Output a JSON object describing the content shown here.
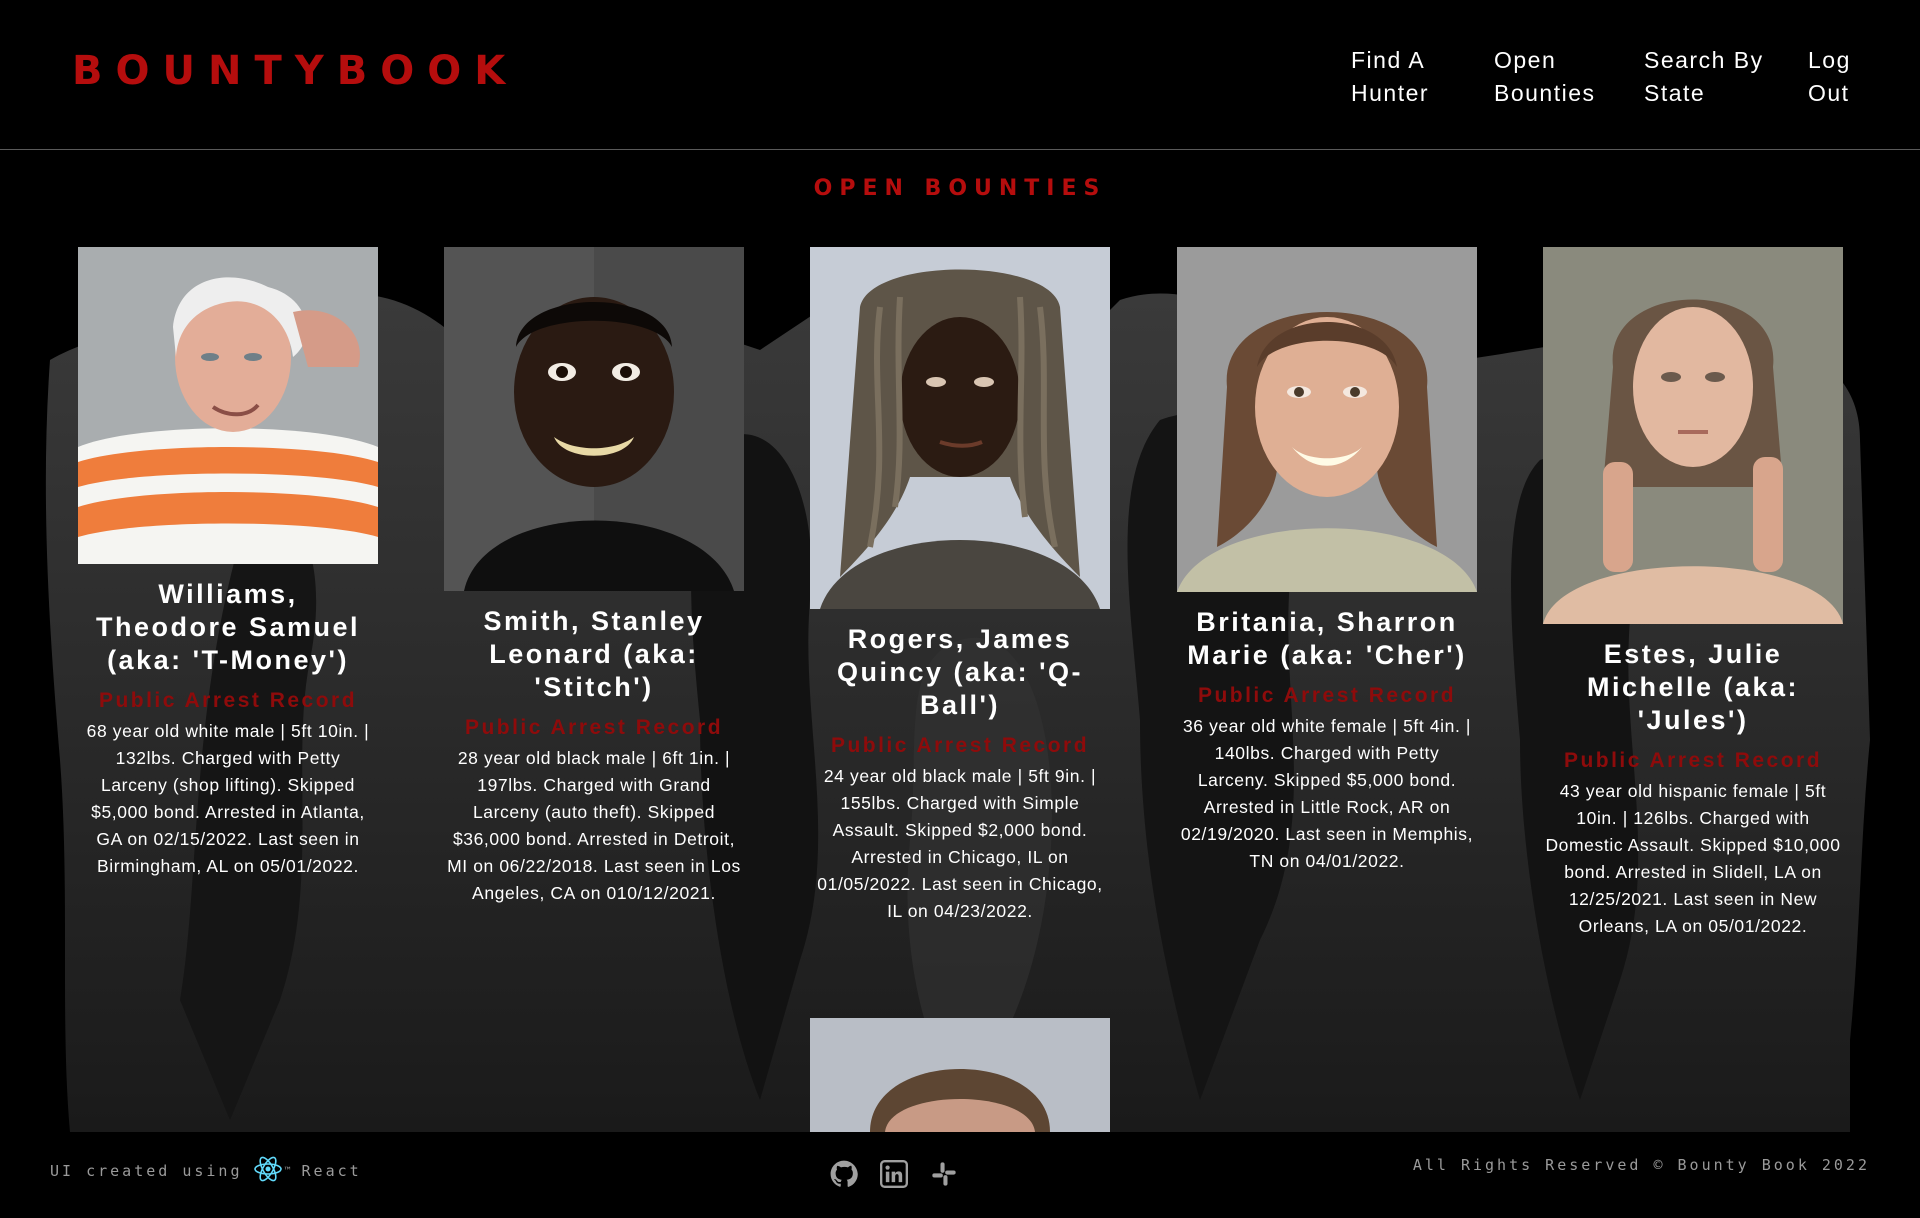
{
  "header": {
    "logo": "BOUNTYBOOK",
    "nav": [
      {
        "line1": "Find A",
        "line2": "Hunter"
      },
      {
        "line1": "Open",
        "line2": "Bounties"
      },
      {
        "line1": "Search By",
        "line2": "State"
      },
      {
        "line1": "Log",
        "line2": "Out"
      }
    ]
  },
  "main": {
    "title": "OPEN BOUNTIES",
    "cards": [
      {
        "name": "Williams, Theodore Samuel (aka: 'T-Money')",
        "record_label": "Public Arrest Record",
        "description": "68 year old white male | 5ft 10in. | 132lbs. Charged with Petty Larceny (shop lifting). Skipped $5,000 bond. Arrested in Atlanta, GA on 02/15/2022. Last seen in Birmingham, AL on 05/01/2022."
      },
      {
        "name": "Smith, Stanley Leonard (aka: 'Stitch')",
        "record_label": "Public Arrest Record",
        "description": "28 year old black male | 6ft 1in. | 197lbs. Charged with Grand Larceny (auto theft). Skipped $36,000 bond. Arrested in Detroit, MI on 06/22/2018. Last seen in Los Angeles, CA on 010/12/2021."
      },
      {
        "name": "Rogers, James Quincy (aka: 'Q-Ball')",
        "record_label": "Public Arrest Record",
        "description": "24 year old black male | 5ft 9in. | 155lbs. Charged with Simple Assault. Skipped $2,000 bond. Arrested in Chicago, IL on 01/05/2022. Last seen in Chicago, IL on 04/23/2022."
      },
      {
        "name": "Britania, Sharron Marie (aka: 'Cher')",
        "record_label": "Public Arrest Record",
        "description": "36 year old white female | 5ft 4in. | 140lbs. Charged with Petty Larceny. Skipped $5,000 bond. Arrested in Little Rock, AR on 02/19/2020. Last seen in Memphis, TN on 04/01/2022."
      },
      {
        "name": "Estes, Julie Michelle (aka: 'Jules')",
        "record_label": "Public Arrest Record",
        "description": "43 year old hispanic female | 5ft 10in. | 126lbs. Charged with Domestic Assault. Skipped $10,000 bond. Arrested in Slidell, LA on 12/25/2021. Last seen in New Orleans, LA on 05/01/2022."
      }
    ]
  },
  "footer": {
    "credit_left": "UI created using",
    "credit_right": "React",
    "trademark": "™",
    "rights": "All Rights Reserved © Bounty Book 2022",
    "socials": [
      "github-icon",
      "linkedin-icon",
      "slack-icon"
    ]
  },
  "colors": {
    "brand_red": "#b50d0d",
    "record_red": "#8e0b0b",
    "background": "#000000"
  }
}
